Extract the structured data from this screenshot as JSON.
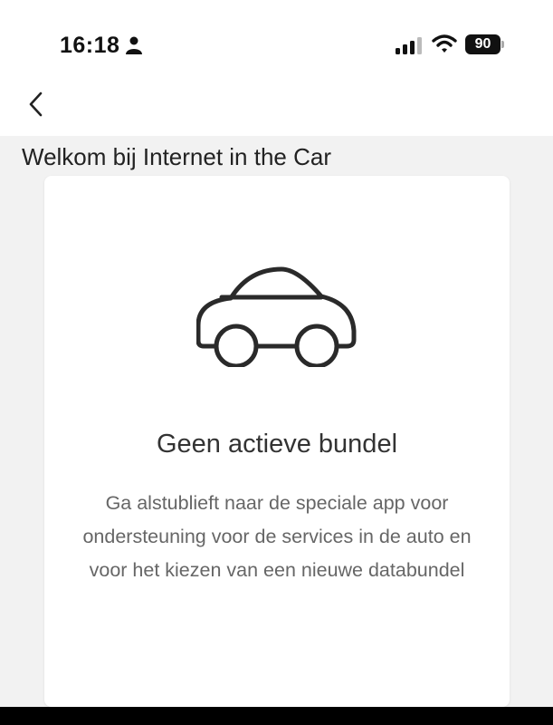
{
  "status_bar": {
    "time": "16:18",
    "battery_level": "90",
    "icons": [
      "person-icon",
      "signal-icon",
      "wifi-icon",
      "battery-icon"
    ]
  },
  "navigation": {
    "back_icon": "chevron-left-icon"
  },
  "page": {
    "title": "Welkom bij Internet in the Car"
  },
  "card": {
    "icon": "car-icon",
    "heading": "Geen actieve bundel",
    "body": "Ga alstublieft naar de speciale app voor ondersteuning voor de services in de auto en voor het kiezen van een nieuwe databundel"
  },
  "colors": {
    "page_background": "#f2f2f2",
    "card_background": "#ffffff",
    "text_dark": "#222222",
    "text_muted": "#666666"
  }
}
